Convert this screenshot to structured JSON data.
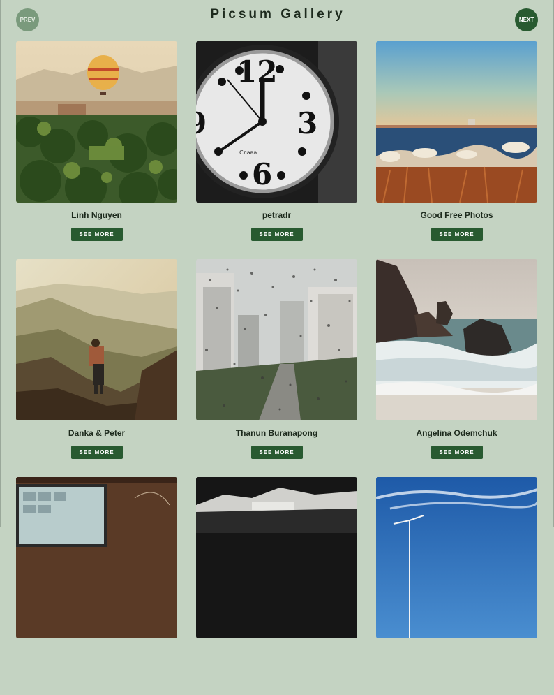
{
  "header": {
    "title": "Picsum Gallery",
    "prev_label": "PREV",
    "next_label": "NEXT"
  },
  "cards": [
    {
      "author": "Linh Nguyen",
      "button": "SEE MORE",
      "image": "hot-air-balloon-over-palm-oasis"
    },
    {
      "author": "petradr",
      "button": "SEE MORE",
      "image": "black-and-white-clock-face"
    },
    {
      "author": "Good Free Photos",
      "button": "SEE MORE",
      "image": "sea-horizon-with-rocky-shore"
    },
    {
      "author": "Danka & Peter",
      "button": "SEE MORE",
      "image": "hiker-in-misty-mountains"
    },
    {
      "author": "Thanun Buranapong",
      "button": "SEE MORE",
      "image": "rain-drops-on-window-city"
    },
    {
      "author": "Angelina Odemchuk",
      "button": "SEE MORE",
      "image": "rocky-coast-waves"
    },
    {
      "author": "",
      "button": "",
      "image": "desk-with-laptop"
    },
    {
      "author": "",
      "button": "",
      "image": "dark-interior"
    },
    {
      "author": "",
      "button": "",
      "image": "blue-sky-wind-turbine"
    }
  ],
  "colors": {
    "background": "#c4d3c2",
    "button": "#285a30",
    "prev_button": "#7a9a7c"
  }
}
